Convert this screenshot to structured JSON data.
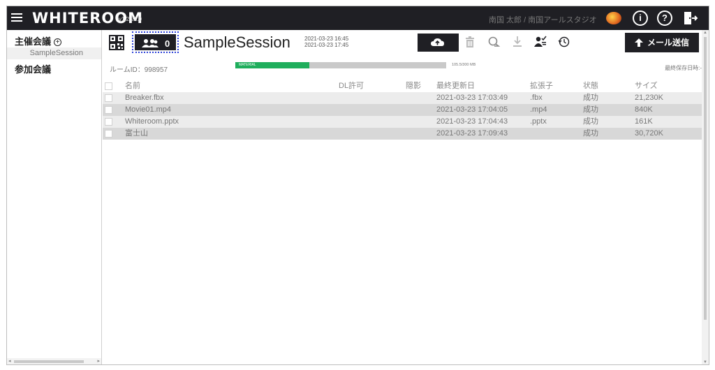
{
  "header": {
    "brand": "WHITEROOM",
    "version": "v1.2.22.0",
    "user": "南国 太郎 / 南国アールスタジオ",
    "info_glyph": "i",
    "help_glyph": "?"
  },
  "sidebar": {
    "hosted_label": "主催会議",
    "plus_glyph": "+",
    "session_item": "SampleSession",
    "joined_label": "参加会議"
  },
  "toolbar": {
    "members_count": "0",
    "session_title": "SampleSession",
    "date_start": "2021-03-23 16:45",
    "date_end": "2021-03-23 17:45",
    "mail_button": "メール送信",
    "icons": [
      "qr-code-icon",
      "members-icon",
      "cloud-upload-icon",
      "trash-icon",
      "search-icon",
      "download-icon",
      "user-check-icon",
      "history-icon",
      "arrow-up-icon"
    ]
  },
  "room": {
    "room_id_label": "ルームID：998957",
    "storage_tag": "MATERIAL",
    "storage_text": "105.5/300 MB",
    "storage_fraction": 0.352,
    "last_saved": "最終保存日時:-"
  },
  "table": {
    "columns": [
      "名前",
      "DL許可",
      "隠影",
      "最終更新日",
      "拡張子",
      "状態",
      "サイズ"
    ],
    "rows": [
      {
        "name": "Breaker.fbx",
        "dl": "",
        "hide": "",
        "date": "2021-03-23 17:03:49",
        "ext": ".fbx",
        "state": "成功",
        "size": "21,230K"
      },
      {
        "name": "Movie01.mp4",
        "dl": "",
        "hide": "",
        "date": "2021-03-23 17:04:05",
        "ext": ".mp4",
        "state": "成功",
        "size": "840K"
      },
      {
        "name": "Whiteroom.pptx",
        "dl": "",
        "hide": "",
        "date": "2021-03-23 17:04:43",
        "ext": ".pptx",
        "state": "成功",
        "size": "161K"
      },
      {
        "name": "富士山",
        "dl": "",
        "hide": "",
        "date": "2021-03-23 17:09:43",
        "ext": "",
        "state": "成功",
        "size": "30,720K"
      }
    ]
  },
  "colors": {
    "header_bg": "#1f1f24",
    "accent_green": "#1fae5c",
    "focus_outline": "#2a3fd6"
  }
}
